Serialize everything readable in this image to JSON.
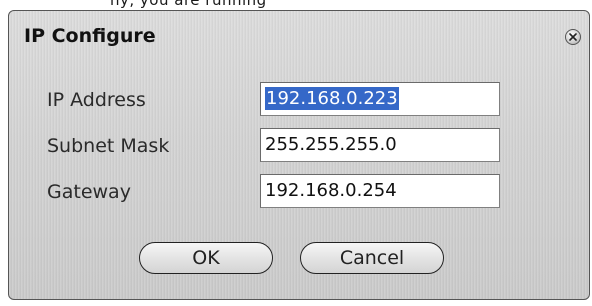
{
  "top_fragment": "ny, you are running",
  "dialog": {
    "title": "IP Configure",
    "close_icon": "close-icon",
    "fields": [
      {
        "label": "IP Address",
        "value": "192.168.0.223",
        "selected": true
      },
      {
        "label": "Subnet Mask",
        "value": "255.255.255.0",
        "selected": false
      },
      {
        "label": "Gateway",
        "value": "192.168.0.254",
        "selected": false
      }
    ],
    "buttons": {
      "ok": "OK",
      "cancel": "Cancel"
    }
  },
  "colors": {
    "selection": "#3568c8",
    "dialog_bg": "#d4d4d4",
    "field_bg": "#ffffff"
  }
}
